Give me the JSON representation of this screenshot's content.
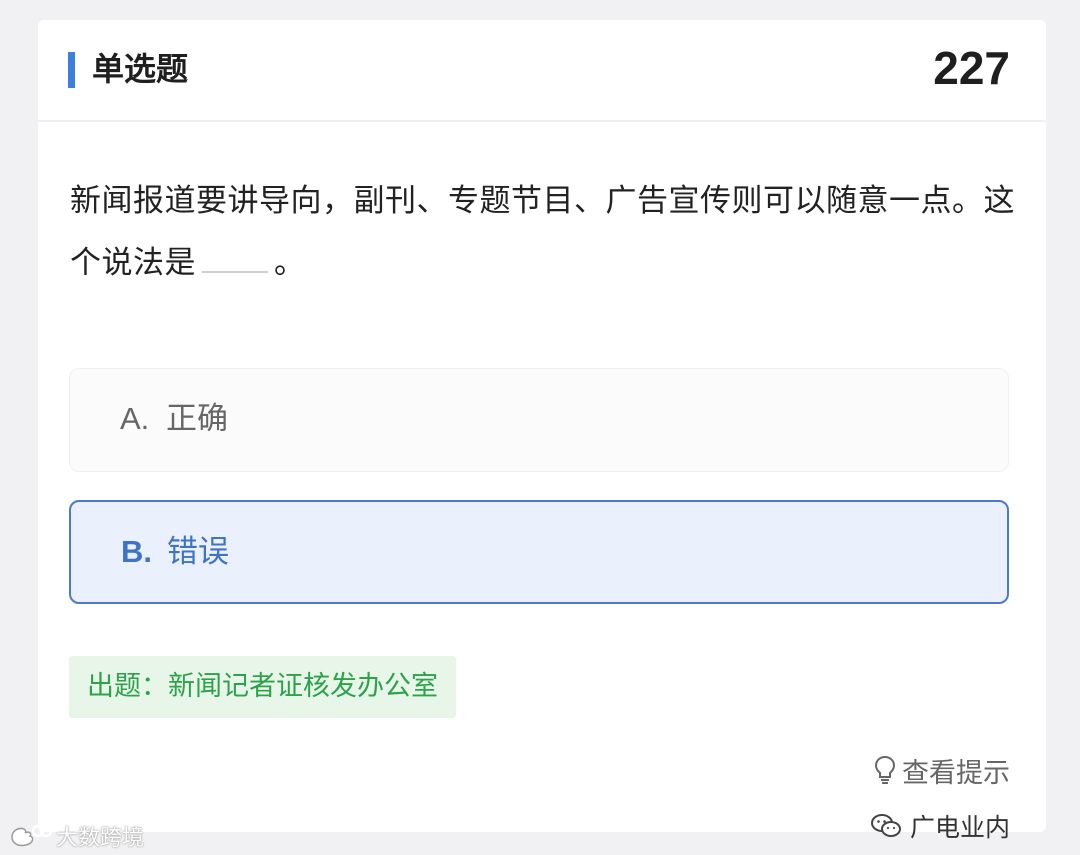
{
  "header": {
    "title": "单选题",
    "question_number": "227"
  },
  "question": {
    "text_before_blank": "新闻报道要讲导向，副刊、专题节目、广告宣传则可以随意一点。这个说法是",
    "text_after_blank": "。"
  },
  "options": [
    {
      "letter": "A.",
      "text": "正确",
      "selected": false
    },
    {
      "letter": "B.",
      "text": "错误",
      "selected": true
    }
  ],
  "source": {
    "label": "出题：新闻记者证核发办公室"
  },
  "hint": {
    "icon": "lightbulb-icon",
    "label": "查看提示"
  },
  "watermarks": {
    "right": "广电业内",
    "right_icon": "wechat-icon",
    "left": "大数跨境",
    "left_icon": "weibo-icon"
  },
  "colors": {
    "accent": "#3d7fe0",
    "selected_border": "#4b7ac9",
    "selected_background": "#eaf1fc",
    "source_text": "#2ea24a",
    "source_background": "#e8f6ea"
  }
}
